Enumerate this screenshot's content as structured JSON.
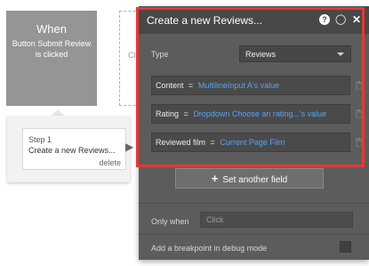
{
  "event": {
    "title": "When",
    "description": "Button Submit Review is clicked"
  },
  "partial_next_step_text": "Cli",
  "step": {
    "number": "Step 1",
    "title": "Create a new Reviews...",
    "delete_label": "delete"
  },
  "panel": {
    "title": "Create a new Reviews...",
    "help_glyph": "?",
    "comment_glyph": "◯",
    "close_glyph": "✕",
    "type_label": "Type",
    "type_value": "Reviews",
    "fields": [
      {
        "name": "Content",
        "eq": "=",
        "value": "MultilineInput A's value"
      },
      {
        "name": "Rating",
        "eq": "=",
        "value": "Dropdown Choose an rating...'s value"
      },
      {
        "name": "Reviewed film",
        "eq": "=",
        "value": "Current Page Film"
      }
    ],
    "set_another_field_icon": "+",
    "set_another_field_label": "Set another field",
    "only_when_label": "Only when",
    "only_when_placeholder": "Click",
    "breakpoint_label": "Add a breakpoint in debug mode"
  },
  "icons": [
    "help-icon",
    "comment-icon",
    "close-icon",
    "trash-icon",
    "plus-icon",
    "chevron-down-icon",
    "arrow-right-icon"
  ],
  "colors": {
    "highlight_outline": "#e53935",
    "dynamic_value": "#5aa3f0",
    "panel_background": "#5c5c5c",
    "panel_header": "#484848",
    "event_block": "#959595"
  }
}
